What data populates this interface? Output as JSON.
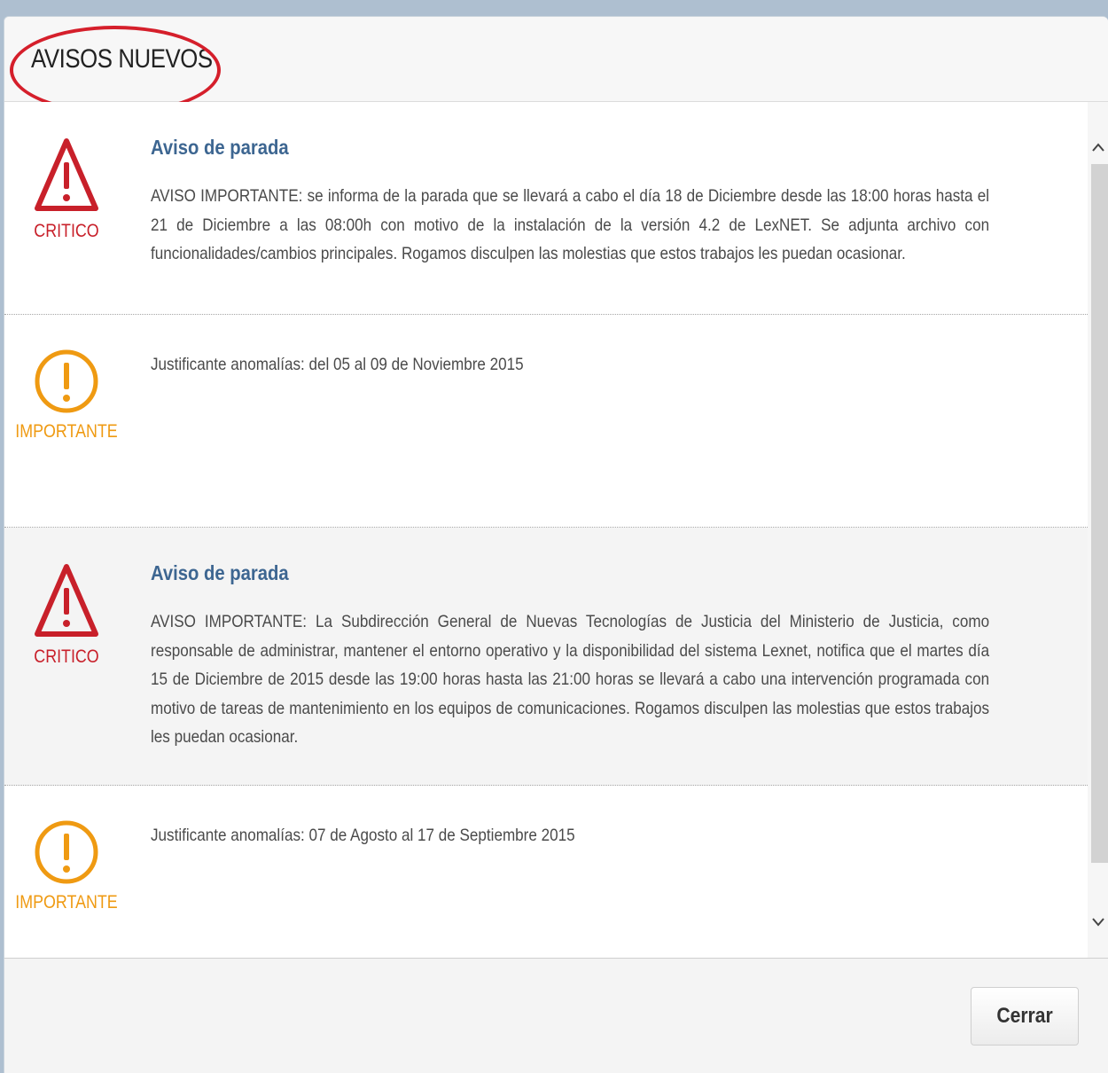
{
  "dialog": {
    "title": "AVISOS NUEVOS",
    "close_label": "Cerrar"
  },
  "notices": [
    {
      "level": "CRITICO",
      "icon": "warning-triangle-icon",
      "title": "Aviso de parada",
      "body": "AVISO IMPORTANTE: se informa de la parada que se llevará a cabo el día 18 de Diciembre desde las 18:00 horas hasta el 21 de Diciembre a las 08:00h con motivo de la instalación de la versión 4.2 de LexNET. Se adjunta archivo con funcionalidades/cambios principales. Rogamos disculpen las molestias que estos trabajos les puedan ocasionar."
    },
    {
      "level": "IMPORTANTE",
      "icon": "exclamation-circle-icon",
      "title": "",
      "body": "Justificante anomalías: del 05 al 09 de Noviembre 2015"
    },
    {
      "level": "CRITICO",
      "icon": "warning-triangle-icon",
      "title": "Aviso de parada",
      "body": "AVISO IMPORTANTE: La Subdirección General de Nuevas Tecnologías de Justicia del Ministerio de Justicia, como responsable de administrar, mantener el entorno operativo y la disponibilidad del sistema Lexnet, notifica que el martes día 15 de Diciembre de 2015 desde las 19:00 horas hasta las 21:00 horas se llevará a cabo una intervención programada con motivo de tareas de mantenimiento en los equipos de comunicaciones. Rogamos disculpen las molestias que estos trabajos les puedan ocasionar."
    },
    {
      "level": "IMPORTANTE",
      "icon": "exclamation-circle-icon",
      "title": "",
      "body": "Justificante anomalías: 07 de Agosto al 17 de Septiembre 2015"
    }
  ],
  "scrollbar": {
    "up_icon": "chevron-up-icon",
    "down_icon": "chevron-down-icon"
  },
  "colors": {
    "critico": "#c8202a",
    "importante": "#ef9a12",
    "title_link": "#3d6691",
    "highlight": "#d51f2b"
  }
}
